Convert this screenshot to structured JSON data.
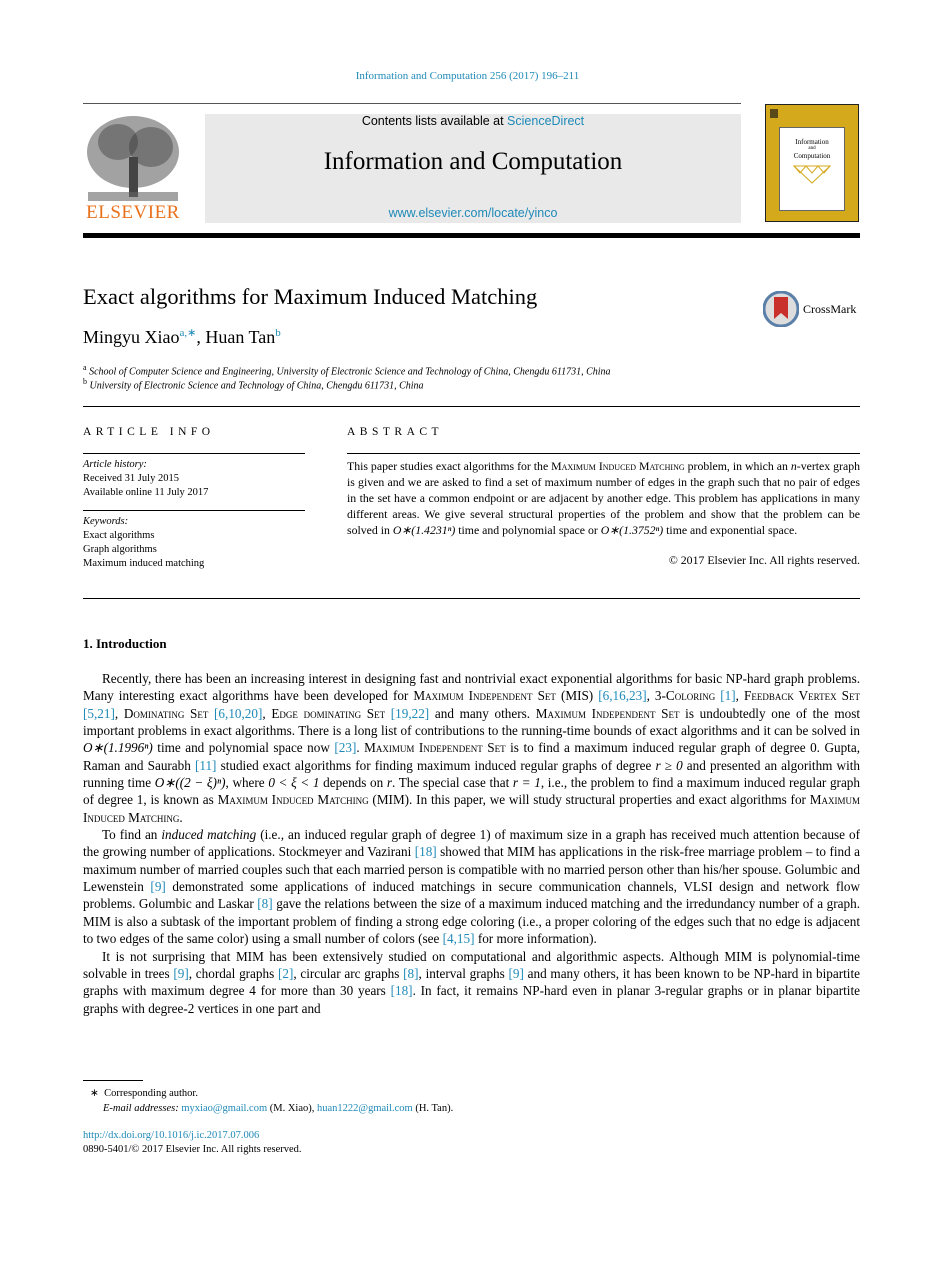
{
  "header": {
    "journal_ref": "Information and Computation 256 (2017) 196–211",
    "contents_prefix": "Contents lists available at ",
    "contents_link": "ScienceDirect",
    "journal_title": "Information and Computation",
    "journal_url": "www.elsevier.com/locate/yinco",
    "publisher_logo_text": "ELSEVIER",
    "cover": {
      "line1": "Information",
      "line2": "and",
      "line3": "Computation"
    }
  },
  "article": {
    "title": "Exact algorithms for Maximum Induced Matching",
    "crossmark_label": "CrossMark",
    "authors": [
      {
        "name": "Mingyu Xiao",
        "sup": "a,∗"
      },
      {
        "name": "Huan Tan",
        "sup": "b"
      }
    ],
    "affiliations": [
      {
        "mark": "a",
        "text": "School of Computer Science and Engineering, University of Electronic Science and Technology of China, Chengdu 611731, China"
      },
      {
        "mark": "b",
        "text": "University of Electronic Science and Technology of China, Chengdu 611731, China"
      }
    ]
  },
  "article_info": {
    "heading": "ARTICLE INFO",
    "history_label": "Article history:",
    "received": "Received 31 July 2015",
    "available": "Available online 11 July 2017",
    "keywords_label": "Keywords:",
    "keywords": [
      "Exact algorithms",
      "Graph algorithms",
      "Maximum induced matching"
    ]
  },
  "abstract": {
    "heading": "ABSTRACT",
    "text_1": "This paper studies exact algorithms for the ",
    "sc_1": "Maximum Induced Matching",
    "text_2": " problem, in which an ",
    "n": "n",
    "text_3": "-vertex graph is given and we are asked to find a set of maximum number of edges in the graph such that no pair of edges in the set have a common endpoint or are adjacent by another edge. This problem has applications in many different areas. We give several structural properties of the problem and show that the problem can be solved in ",
    "bound_1": "O∗(1.4231ⁿ)",
    "text_4": " time and polynomial space or ",
    "bound_2": "O∗(1.3752ⁿ)",
    "text_5": " time and exponential space.",
    "copyright": "© 2017 Elsevier Inc. All rights reserved."
  },
  "intro": {
    "heading": "1. Introduction",
    "p1": [
      {
        "t": "Recently, there has been an increasing interest in designing fast and nontrivial exact exponential algorithms for basic NP-hard graph problems. Many interesting exact algorithms have been developed for "
      },
      {
        "sc": "Maximum Independent Set"
      },
      {
        "t": " (MIS) "
      },
      {
        "ref": "[6,16,23]"
      },
      {
        "t": ", 3-"
      },
      {
        "sc": "Coloring"
      },
      {
        "t": " "
      },
      {
        "ref": "[1]"
      },
      {
        "t": ", "
      },
      {
        "sc": "Feedback Vertex Set"
      },
      {
        "t": " "
      },
      {
        "ref": "[5,21]"
      },
      {
        "t": ", "
      },
      {
        "sc": "Dominating Set"
      },
      {
        "t": " "
      },
      {
        "ref": "[6,10,20]"
      },
      {
        "t": ", "
      },
      {
        "sc": "Edge dominating Set"
      },
      {
        "t": " "
      },
      {
        "ref": "[19,22]"
      },
      {
        "t": " and many others. "
      },
      {
        "sc": "Maximum Independent Set"
      },
      {
        "t": " is undoubtedly one of the most important problems in exact algorithms. There is a long list of contributions to the running-time bounds of exact algorithms and it can be solved in "
      },
      {
        "i": "O∗(1.1996ⁿ)"
      },
      {
        "t": " time and polynomial space now "
      },
      {
        "ref": "[23]"
      },
      {
        "t": ". "
      },
      {
        "sc": "Maximum Independent Set"
      },
      {
        "t": " is to find a maximum induced regular graph of degree 0. Gupta, Raman and Saurabh "
      },
      {
        "ref": "[11]"
      },
      {
        "t": " studied exact algorithms for finding maximum induced regular graphs of degree "
      },
      {
        "i": "r ≥ 0"
      },
      {
        "t": " and presented an algorithm with running time "
      },
      {
        "i": "O∗((2 − ξ)ⁿ)"
      },
      {
        "t": ", where "
      },
      {
        "i": "0 < ξ < 1"
      },
      {
        "t": " depends on "
      },
      {
        "i": "r"
      },
      {
        "t": ". The special case that "
      },
      {
        "i": "r = 1"
      },
      {
        "t": ", i.e., the problem to find a maximum induced regular graph of degree 1, is known as "
      },
      {
        "sc": "Maximum Induced Matching"
      },
      {
        "t": " (MIM). In this paper, we will study structural properties and exact algorithms for "
      },
      {
        "sc": "Maximum Induced Matching"
      },
      {
        "t": "."
      }
    ],
    "p2": [
      {
        "t": "To find an "
      },
      {
        "i": "induced matching"
      },
      {
        "t": " (i.e., an induced regular graph of degree 1) of maximum size in a graph has received much attention because of the growing number of applications. Stockmeyer and Vazirani "
      },
      {
        "ref": "[18]"
      },
      {
        "t": " showed that MIM has applications in the risk-free marriage problem – to find a maximum number of married couples such that each married person is compatible with no married person other than his/her spouse. Golumbic and Lewenstein "
      },
      {
        "ref": "[9]"
      },
      {
        "t": " demonstrated some applications of induced matchings in secure communication channels, VLSI design and network flow problems. Golumbic and Laskar "
      },
      {
        "ref": "[8]"
      },
      {
        "t": " gave the relations between the size of a maximum induced matching and the irredundancy number of a graph. MIM is also a subtask of the important problem of finding a strong edge coloring (i.e., a proper coloring of the edges such that no edge is adjacent to two edges of the same color) using a small number of colors (see "
      },
      {
        "ref": "[4,15]"
      },
      {
        "t": " for more information)."
      }
    ],
    "p3": [
      {
        "t": "It is not surprising that MIM has been extensively studied on computational and algorithmic aspects. Although MIM is polynomial-time solvable in trees "
      },
      {
        "ref": "[9]"
      },
      {
        "t": ", chordal graphs "
      },
      {
        "ref": "[2]"
      },
      {
        "t": ", circular arc graphs "
      },
      {
        "ref": "[8]"
      },
      {
        "t": ", interval graphs "
      },
      {
        "ref": "[9]"
      },
      {
        "t": " and many others, it has been known to be NP-hard in bipartite graphs with maximum degree 4 for more than 30 years "
      },
      {
        "ref": "[18]"
      },
      {
        "t": ". In fact, it remains NP-hard even in planar 3-regular graphs or in planar bipartite graphs with degree-2 vertices in one part and"
      }
    ]
  },
  "footnotes": {
    "star": "∗",
    "corresponding": "Corresponding author.",
    "email_label": "E-mail addresses:",
    "email_1": "myxiao@gmail.com",
    "email_1_who": " (M. Xiao), ",
    "email_2": "huan1222@gmail.com",
    "email_2_who": " (H. Tan).",
    "doi": "http://dx.doi.org/10.1016/j.ic.2017.07.006",
    "issn": "0890-5401/© 2017 Elsevier Inc. All rights reserved."
  },
  "colors": {
    "link": "#1f8ab8",
    "elsevier_orange": "#e9711c",
    "cover_gold": "#d4a91c",
    "masthead_bg": "#e9e9e9"
  }
}
